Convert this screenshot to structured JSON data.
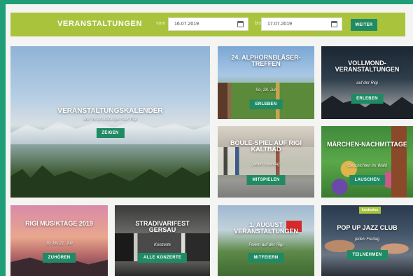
{
  "filter": {
    "title": "VERANSTALTUNGEN",
    "from_label": "vom",
    "from_date": "16.07.2019",
    "to_label": "bis",
    "to_date": "17.07.2019",
    "submit_label": "WEITER"
  },
  "tiles": [
    {
      "title": "VERANSTALTUNGSKALENDER",
      "subtitle": "alle Veranstaltungen der Rigi",
      "button": "ZEIGEN"
    },
    {
      "title": "24. ALPHORNBLÄSER-TREFFEN",
      "subtitle": "So, 28. Juli",
      "button": "ERLEBEN"
    },
    {
      "title": "VOLLMOND-VERANSTALTUNGEN",
      "subtitle": "auf der Rigi",
      "button": "ERLEBEN"
    },
    {
      "title": "BOULE-SPIEL AUF RIGI KALTBAD",
      "subtitle": "jeden Sonntag",
      "button": "MITSPIELEN"
    },
    {
      "title": "MÄRCHEN-NACHMITTAGE",
      "subtitle": "Geschichten im Wald",
      "button": "LAUSCHEN"
    },
    {
      "title": "RIGI MUSIKTAGE 2019",
      "subtitle": "19. bis 21. Juli",
      "button": "ZUHÖREN"
    },
    {
      "title": "STRADIVARIFEST GERSAU",
      "subtitle": "Konzerte",
      "button": "ALLE KONZERTE"
    },
    {
      "title": "1. AUGUST VERANSTALTUNGEN",
      "subtitle": "Feiern auf der Rigi",
      "button": "MITFEIERN"
    },
    {
      "title": "POP UP JAZZ CLUB",
      "subtitle": "jeden Freitag",
      "button": "TEILNEHMEN",
      "badge": "kostenlos"
    }
  ]
}
